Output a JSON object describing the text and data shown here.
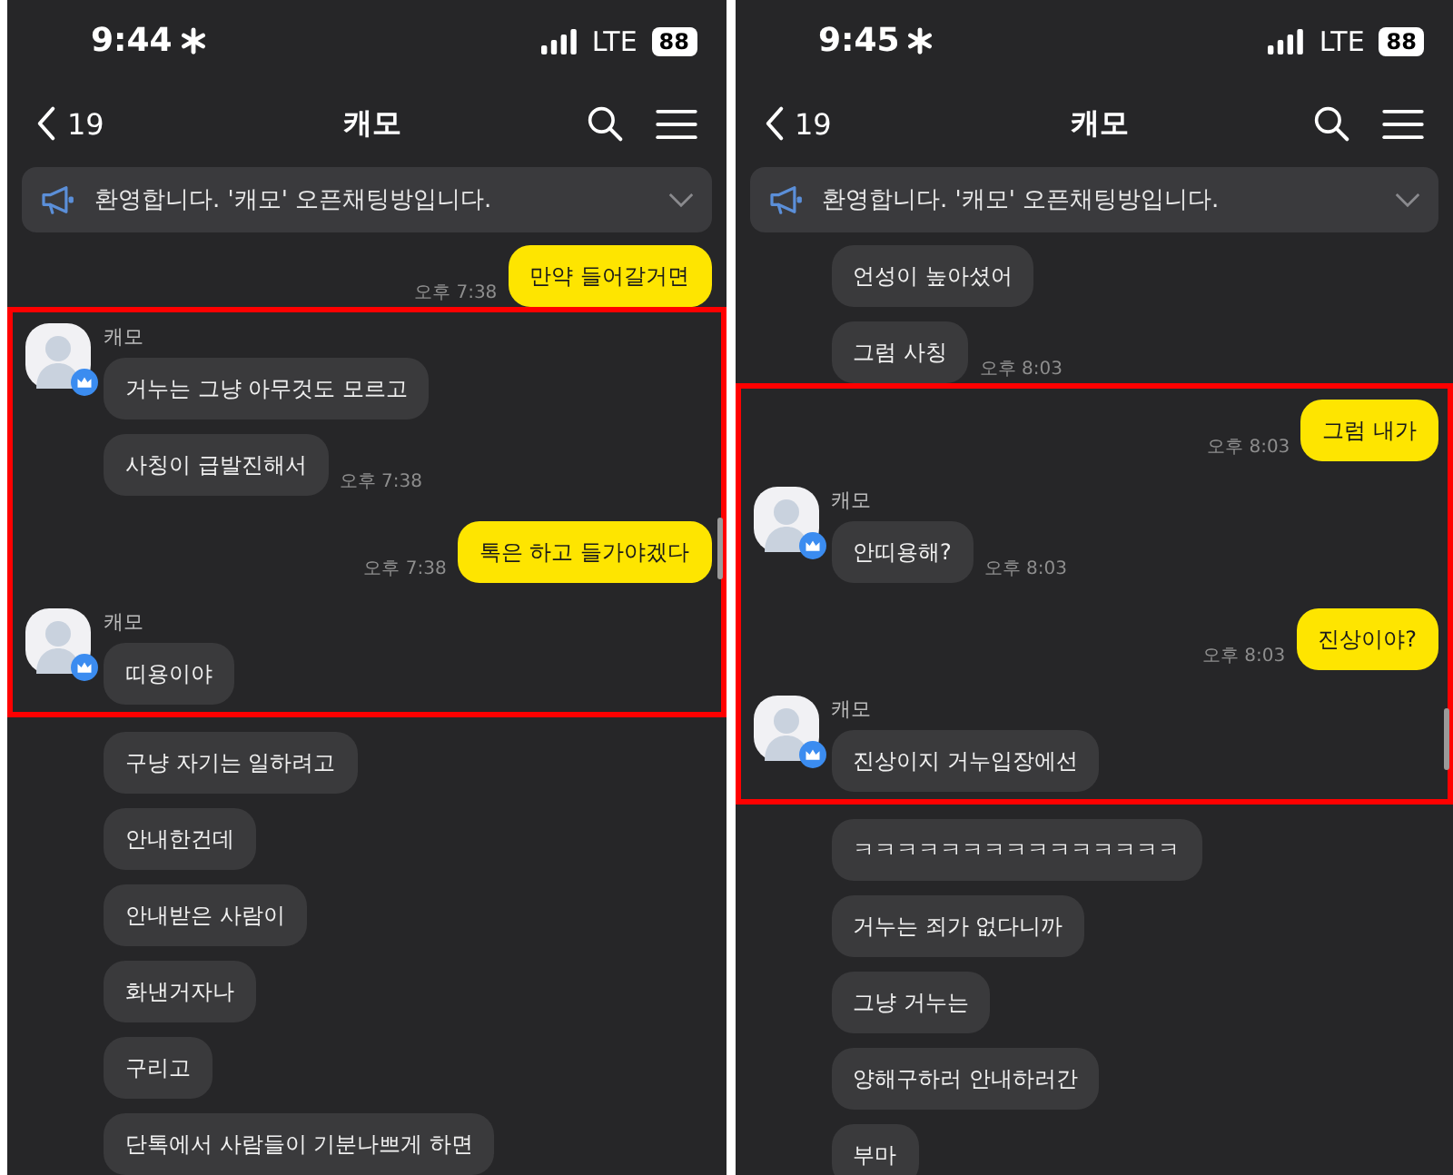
{
  "panels": [
    {
      "status_bar": {
        "time": "9:44",
        "network": "LTE",
        "battery": "88"
      },
      "nav": {
        "back_count": "19",
        "title": "캐모"
      },
      "notice": {
        "text": "환영합니다. '캐모' 오픈채팅방입니다."
      },
      "messages": [
        {
          "kind": "mine",
          "text": "만약 들어갈거면",
          "time": "오후 7:38",
          "highlighted": false
        },
        {
          "kind": "theirs",
          "sender": "캐모",
          "text": "거누는 그냥 아무것도 모르고",
          "highlighted": true
        },
        {
          "kind": "theirs",
          "text": "사칭이 급발진해서",
          "time": "오후 7:38",
          "highlighted": true
        },
        {
          "kind": "mine",
          "text": "톡은 하고 들가야겠다",
          "time": "오후 7:38",
          "highlighted": true
        },
        {
          "kind": "theirs",
          "sender": "캐모",
          "text": "띠용이야",
          "highlighted": true
        },
        {
          "kind": "theirs",
          "text": "구냥 자기는 일하려고",
          "highlighted": false
        },
        {
          "kind": "theirs",
          "text": "안내한건데",
          "highlighted": false
        },
        {
          "kind": "theirs",
          "text": "안내받은 사람이",
          "highlighted": false
        },
        {
          "kind": "theirs",
          "text": "화낸거자나",
          "highlighted": false
        },
        {
          "kind": "theirs",
          "text": "구리고",
          "highlighted": false
        },
        {
          "kind": "theirs",
          "text": "단톡에서 사람들이 기분나쁘게 하면",
          "highlighted": false
        }
      ]
    },
    {
      "status_bar": {
        "time": "9:45",
        "network": "LTE",
        "battery": "88"
      },
      "nav": {
        "back_count": "19",
        "title": "캐모"
      },
      "notice": {
        "text": "환영합니다. '캐모' 오픈채팅방입니다."
      },
      "messages": [
        {
          "kind": "theirs",
          "text": "언성이 높아셨어",
          "highlighted": false
        },
        {
          "kind": "theirs",
          "text": "그럼 사칭",
          "time": "오후 8:03",
          "highlighted": false
        },
        {
          "kind": "mine",
          "text": "그럼 내가",
          "time": "오후 8:03",
          "highlighted": true
        },
        {
          "kind": "theirs",
          "sender": "캐모",
          "text": "안띠용해?",
          "time": "오후 8:03",
          "highlighted": true
        },
        {
          "kind": "mine",
          "text": "진상이야?",
          "time": "오후 8:03",
          "highlighted": true
        },
        {
          "kind": "theirs",
          "sender": "캐모",
          "text": "진상이지 거누입장에선",
          "highlighted": true
        },
        {
          "kind": "theirs",
          "text": "ㅋㅋㅋㅋㅋㅋㅋㅋㅋㅋㅋㅋㅋㅋㅋ",
          "highlighted": false
        },
        {
          "kind": "theirs",
          "text": "거누는 죄가 없다니까",
          "highlighted": false
        },
        {
          "kind": "theirs",
          "text": "그냥 거누는",
          "highlighted": false
        },
        {
          "kind": "theirs",
          "text": "양해구하러 안내하러간",
          "highlighted": false
        },
        {
          "kind": "theirs",
          "text": "부마",
          "highlighted": false
        }
      ]
    }
  ]
}
